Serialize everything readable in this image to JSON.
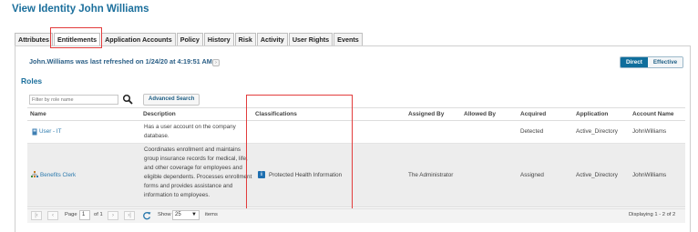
{
  "page_title": "View Identity John Williams",
  "tabs": [
    {
      "label": "Attributes"
    },
    {
      "label": "Entitlements",
      "active": true
    },
    {
      "label": "Application Accounts"
    },
    {
      "label": "Policy"
    },
    {
      "label": "History"
    },
    {
      "label": "Risk"
    },
    {
      "label": "Activity"
    },
    {
      "label": "User Rights"
    },
    {
      "label": "Events"
    }
  ],
  "refresh_text": "John.Williams was last refreshed on 1/24/20 at 4:19:51 AM",
  "view_toggle": {
    "direct": "Direct",
    "effective": "Effective",
    "selected": "Direct"
  },
  "roles_section": {
    "title": "Roles",
    "filter_placeholder": "Filter by role name",
    "advanced_search_label": "Advanced Search",
    "columns": [
      "Name",
      "Description",
      "Classifications",
      "Assigned By",
      "Allowed By",
      "Acquired",
      "Application",
      "Account Name"
    ],
    "rows": [
      {
        "name": "User - IT",
        "icon": "role-icon",
        "description_lines": [
          "Has a user account on the company",
          "database."
        ],
        "classification": "",
        "assigned_by": "",
        "allowed_by": "",
        "acquired": "Detected",
        "application": "Active_Directory",
        "account_name": "JohnWilliams"
      },
      {
        "name": "Benefits Clerk",
        "icon": "hierarchy-icon",
        "description_lines": [
          "Coordinates enrollment and maintains",
          "group insurance records for medical, life,",
          "and other coverage for employees and",
          "eligible dependents. Processes enrollment",
          "forms and provides assistance and",
          "information to employees."
        ],
        "classification": "Protected Health Information",
        "classification_icon": "info-icon",
        "assigned_by": "The Administrator",
        "allowed_by": "",
        "acquired": "Assigned",
        "application": "Active_Directory",
        "account_name": "JohnWilliams"
      }
    ]
  },
  "pagination": {
    "page_label": "Page",
    "current_page": "1",
    "of_label": "of 1",
    "show_label": "Show",
    "page_size": "25",
    "items_label": "items",
    "displaying": "Displaying 1 - 2 of 2"
  },
  "colors": {
    "accent": "#1b6f9c",
    "link": "#2b79ad",
    "highlight_outline": "#e23c3c",
    "toggle_active": "#0f6e9c"
  }
}
